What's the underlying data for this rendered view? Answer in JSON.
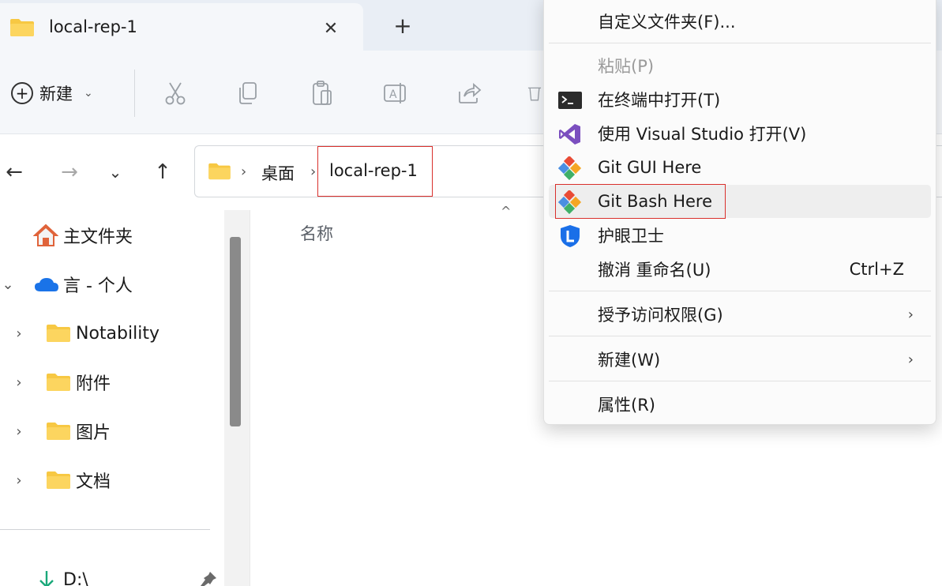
{
  "tab": {
    "title": "local-rep-1",
    "close_glyph": "✕",
    "new_tab_glyph": "+"
  },
  "toolbar": {
    "new_label": "新建",
    "new_chevron": "⌄",
    "icons": [
      "cut-icon",
      "copy-icon",
      "paste-icon",
      "rename-icon",
      "share-icon",
      "delete-icon"
    ]
  },
  "nav": {
    "back": "←",
    "forward": "→",
    "recent": "⌄",
    "up": "↑"
  },
  "address": {
    "separator": "›",
    "crumbs": [
      "桌面",
      "local-rep-1"
    ]
  },
  "sidebar": {
    "items": [
      {
        "label": "主文件夹",
        "icon": "home-icon",
        "expander": ""
      },
      {
        "label": "言 - 个人",
        "icon": "onedrive-cloud-icon",
        "expander": "⌄"
      },
      {
        "label": "Notability",
        "icon": "folder-icon",
        "expander": "›"
      },
      {
        "label": "附件",
        "icon": "folder-icon",
        "expander": "›"
      },
      {
        "label": "图片",
        "icon": "folder-icon",
        "expander": "›"
      },
      {
        "label": "文档",
        "icon": "folder-icon",
        "expander": "›"
      },
      {
        "label": "D:\\",
        "icon": "drive-down-arrow-icon",
        "expander": ""
      }
    ]
  },
  "content": {
    "column_name": "名称",
    "sort_glyph": "^"
  },
  "context_menu": {
    "items": [
      {
        "label": "自定义文件夹(F)...",
        "icon": "",
        "enabled": true
      },
      {
        "label": "粘贴(P)",
        "icon": "",
        "enabled": false
      },
      {
        "label": "在终端中打开(T)",
        "icon": "terminal-icon",
        "enabled": true
      },
      {
        "label": "使用 Visual Studio 打开(V)",
        "icon": "visual-studio-icon",
        "enabled": true
      },
      {
        "label": "Git GUI Here",
        "icon": "git-icon",
        "enabled": true
      },
      {
        "label": "Git Bash Here",
        "icon": "git-icon",
        "enabled": true,
        "hovered": true
      },
      {
        "label": "护眼卫士",
        "icon": "eye-guard-icon",
        "enabled": true
      },
      {
        "label": "撤消 重命名(U)",
        "icon": "",
        "enabled": true,
        "shortcut": "Ctrl+Z"
      },
      {
        "label": "授予访问权限(G)",
        "icon": "",
        "enabled": true,
        "submenu": "›"
      },
      {
        "label": "新建(W)",
        "icon": "",
        "enabled": true,
        "submenu": "›"
      },
      {
        "label": "属性(R)",
        "icon": "",
        "enabled": true
      }
    ]
  },
  "colors": {
    "highlight_border": "#d9302c",
    "folder_yellow": "#f7c843",
    "onedrive_blue": "#1a73e8",
    "vs_purple": "#7b4fbf",
    "git_red": "#e94b35"
  }
}
